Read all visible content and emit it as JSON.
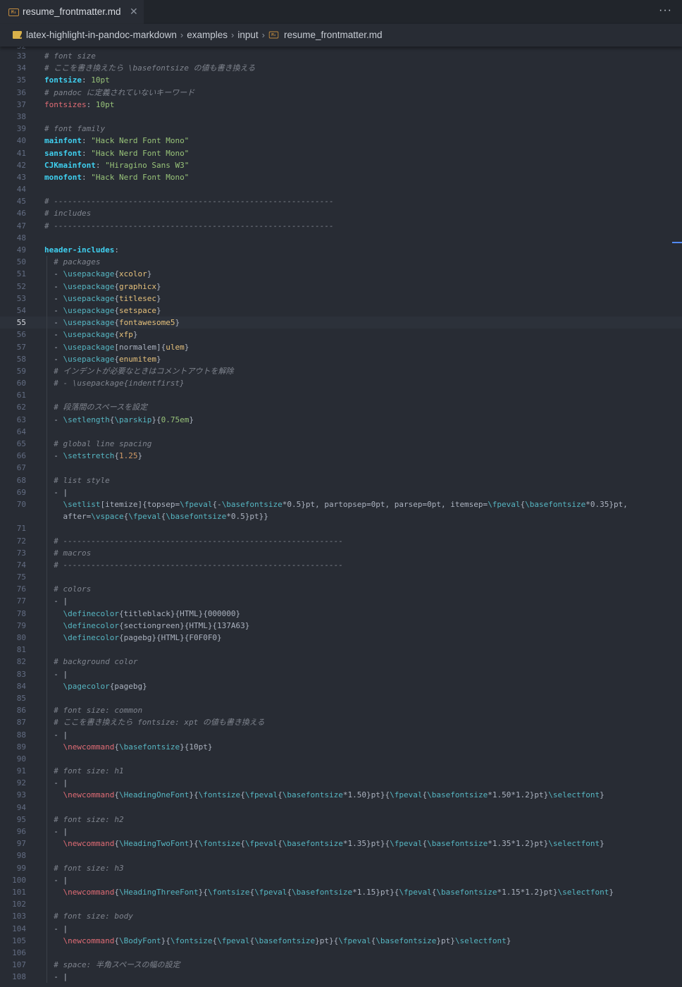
{
  "tab": {
    "filename": "resume_frontmatter.md",
    "icon": "markdown-icon",
    "close": "✕"
  },
  "more_label": "···",
  "breadcrumb": {
    "items": [
      "latex-highlight-in-pandoc-markdown",
      "examples",
      "input",
      "resume_frontmatter.md"
    ],
    "separator": "›"
  },
  "editor": {
    "active_line": 55,
    "first_partial_line": "32"
  },
  "colors": {
    "background": "#282c34",
    "comment": "#7f848e",
    "key": "#3fd0f0",
    "string": "#98c379",
    "command": "#56b6c2",
    "argument": "#e5c07b",
    "number": "#d19a66"
  }
}
